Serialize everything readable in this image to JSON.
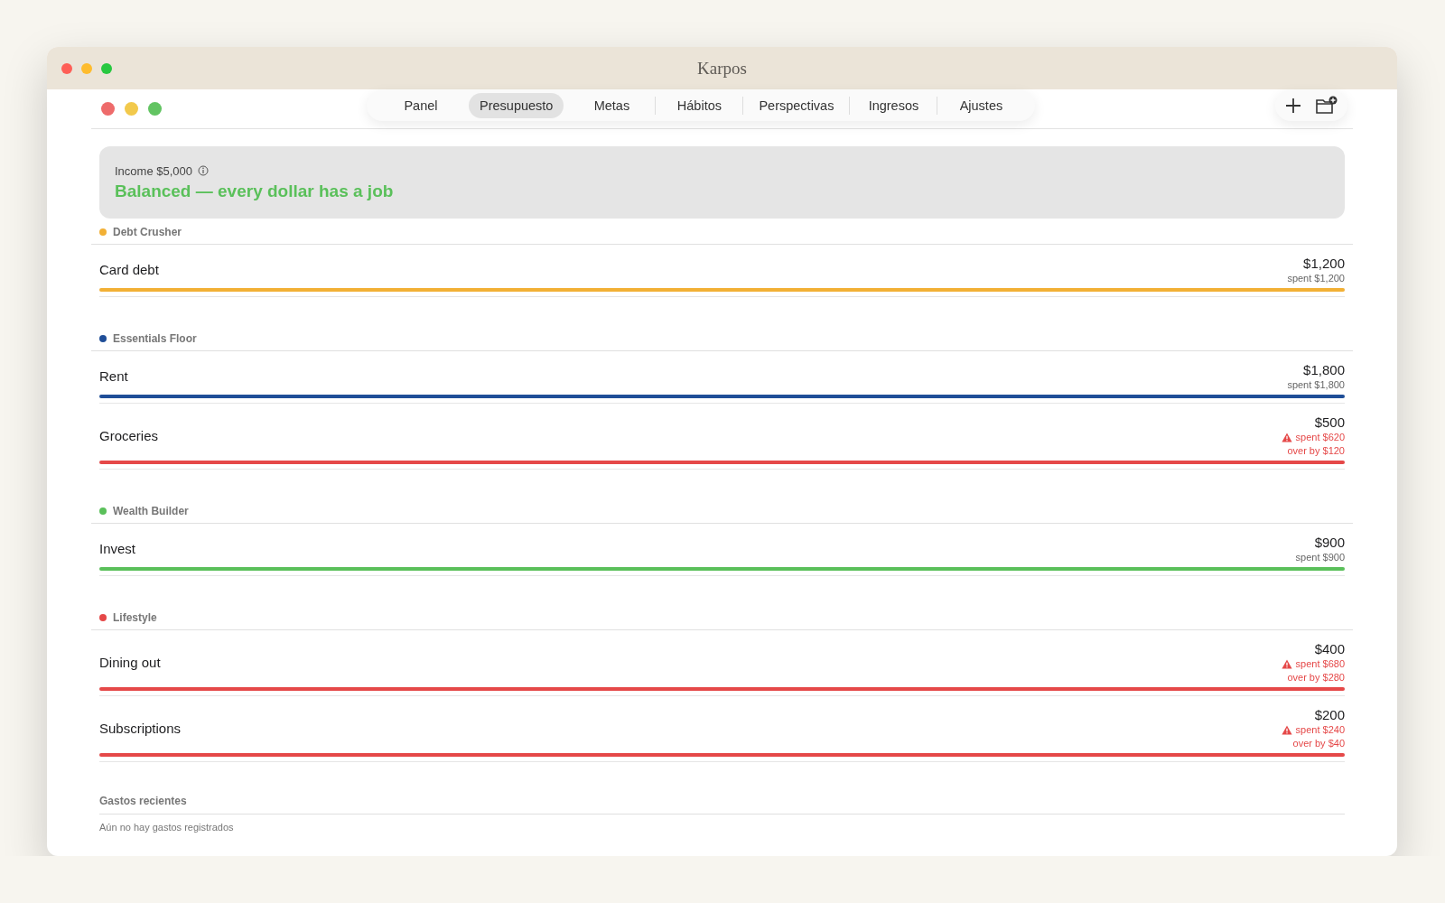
{
  "window": {
    "title": "Karpos"
  },
  "tabs": [
    {
      "label": "Panel",
      "selected": false
    },
    {
      "label": "Presupuesto",
      "selected": true
    },
    {
      "label": "Metas",
      "selected": false
    },
    {
      "label": "Hábitos",
      "selected": false
    },
    {
      "label": "Perspectivas",
      "selected": false
    },
    {
      "label": "Ingresos",
      "selected": false
    },
    {
      "label": "Ajustes",
      "selected": false
    }
  ],
  "summary": {
    "income": "Income $5,000",
    "status": "Balanced — every dollar has a job"
  },
  "groups": [
    {
      "name": "Debt Crusher",
      "color": "#f2b035",
      "items": [
        {
          "name": "Card debt",
          "amount": "$1,200",
          "spent": "spent $1,200",
          "over_budget": false,
          "level": 1
        }
      ]
    },
    {
      "name": "Essentials Floor",
      "color": "#1f4e98",
      "items": [
        {
          "name": "Rent",
          "amount": "$1,800",
          "spent": "spent $1,800",
          "over_budget": false,
          "level": 1
        },
        {
          "name": "Groceries",
          "amount": "$500",
          "spent": "spent $620",
          "over": "over by $120",
          "over_budget": true,
          "level": 1
        }
      ]
    },
    {
      "name": "Wealth Builder",
      "color": "#5ac05a",
      "items": [
        {
          "name": "Invest",
          "amount": "$900",
          "spent": "spent $900",
          "over_budget": false,
          "level": 1
        }
      ]
    },
    {
      "name": "Lifestyle",
      "color": "#e54848",
      "items": [
        {
          "name": "Dining out",
          "amount": "$400",
          "spent": "spent $680",
          "over": "over by $280",
          "over_budget": true,
          "level": 1
        },
        {
          "name": "Subscriptions",
          "amount": "$200",
          "spent": "spent $240",
          "over": "over by $40",
          "over_budget": true,
          "level": 1
        }
      ]
    }
  ],
  "recent": {
    "title": "Gastos recientes",
    "empty": "Aún no hay gastos registrados"
  }
}
